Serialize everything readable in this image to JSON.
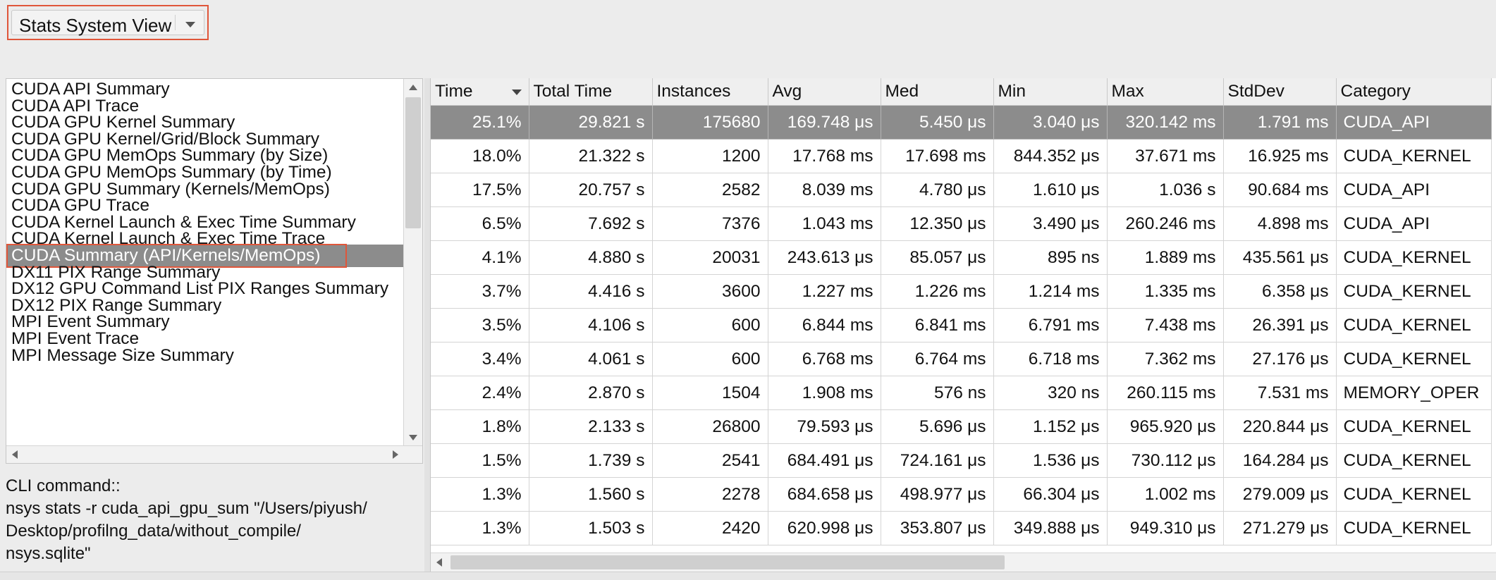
{
  "view_selector": {
    "selected": "Stats System View"
  },
  "report_list": {
    "items": [
      "CUDA API Summary",
      "CUDA API Trace",
      "CUDA GPU Kernel Summary",
      "CUDA GPU Kernel/Grid/Block Summary",
      "CUDA GPU MemOps Summary (by Size)",
      "CUDA GPU MemOps Summary (by Time)",
      "CUDA GPU Summary (Kernels/MemOps)",
      "CUDA GPU Trace",
      "CUDA Kernel Launch & Exec Time Summary",
      "CUDA Kernel Launch & Exec Time Trace",
      "CUDA Summary (API/Kernels/MemOps)",
      "DX11 PIX Range Summary",
      "DX12 GPU Command List PIX Ranges Summary",
      "DX12 PIX Range Summary",
      "MPI Event Summary",
      "MPI Event Trace",
      "MPI Message Size Summary"
    ],
    "selected_index": 10
  },
  "cli": {
    "label": "CLI command::",
    "command": "nsys stats -r cuda_api_gpu_sum \"/Users/piyush/\nDesktop/profilng_data/without_compile/\nnsys.sqlite\""
  },
  "table": {
    "columns": [
      "Time",
      "Total Time",
      "Instances",
      "Avg",
      "Med",
      "Min",
      "Max",
      "StdDev",
      "Category"
    ],
    "sort_column": "Time",
    "selected_row": 0,
    "rows": [
      [
        "25.1%",
        "29.821 s",
        "175680",
        "169.748 μs",
        "5.450 μs",
        "3.040 μs",
        "320.142 ms",
        "1.791 ms",
        "CUDA_API"
      ],
      [
        "18.0%",
        "21.322 s",
        "1200",
        "17.768 ms",
        "17.698 ms",
        "844.352 μs",
        "37.671 ms",
        "16.925 ms",
        "CUDA_KERNEL"
      ],
      [
        "17.5%",
        "20.757 s",
        "2582",
        "8.039 ms",
        "4.780 μs",
        "1.610 μs",
        "1.036 s",
        "90.684 ms",
        "CUDA_API"
      ],
      [
        "6.5%",
        "7.692 s",
        "7376",
        "1.043 ms",
        "12.350 μs",
        "3.490 μs",
        "260.246 ms",
        "4.898 ms",
        "CUDA_API"
      ],
      [
        "4.1%",
        "4.880 s",
        "20031",
        "243.613 μs",
        "85.057 μs",
        "895 ns",
        "1.889 ms",
        "435.561 μs",
        "CUDA_KERNEL"
      ],
      [
        "3.7%",
        "4.416 s",
        "3600",
        "1.227 ms",
        "1.226 ms",
        "1.214 ms",
        "1.335 ms",
        "6.358 μs",
        "CUDA_KERNEL"
      ],
      [
        "3.5%",
        "4.106 s",
        "600",
        "6.844 ms",
        "6.841 ms",
        "6.791 ms",
        "7.438 ms",
        "26.391 μs",
        "CUDA_KERNEL"
      ],
      [
        "3.4%",
        "4.061 s",
        "600",
        "6.768 ms",
        "6.764 ms",
        "6.718 ms",
        "7.362 ms",
        "27.176 μs",
        "CUDA_KERNEL"
      ],
      [
        "2.4%",
        "2.870 s",
        "1504",
        "1.908 ms",
        "576 ns",
        "320 ns",
        "260.115 ms",
        "7.531 ms",
        "MEMORY_OPER"
      ],
      [
        "1.8%",
        "2.133 s",
        "26800",
        "79.593 μs",
        "5.696 μs",
        "1.152 μs",
        "965.920 μs",
        "220.844 μs",
        "CUDA_KERNEL"
      ],
      [
        "1.5%",
        "1.739 s",
        "2541",
        "684.491 μs",
        "724.161 μs",
        "1.536 μs",
        "730.112 μs",
        "164.284 μs",
        "CUDA_KERNEL"
      ],
      [
        "1.3%",
        "1.560 s",
        "2278",
        "684.658 μs",
        "498.977 μs",
        "66.304 μs",
        "1.002 ms",
        "279.009 μs",
        "CUDA_KERNEL"
      ],
      [
        "1.3%",
        "1.503 s",
        "2420",
        "620.998 μs",
        "353.807 μs",
        "349.888 μs",
        "949.310 μs",
        "271.279 μs",
        "CUDA_KERNEL"
      ]
    ]
  }
}
